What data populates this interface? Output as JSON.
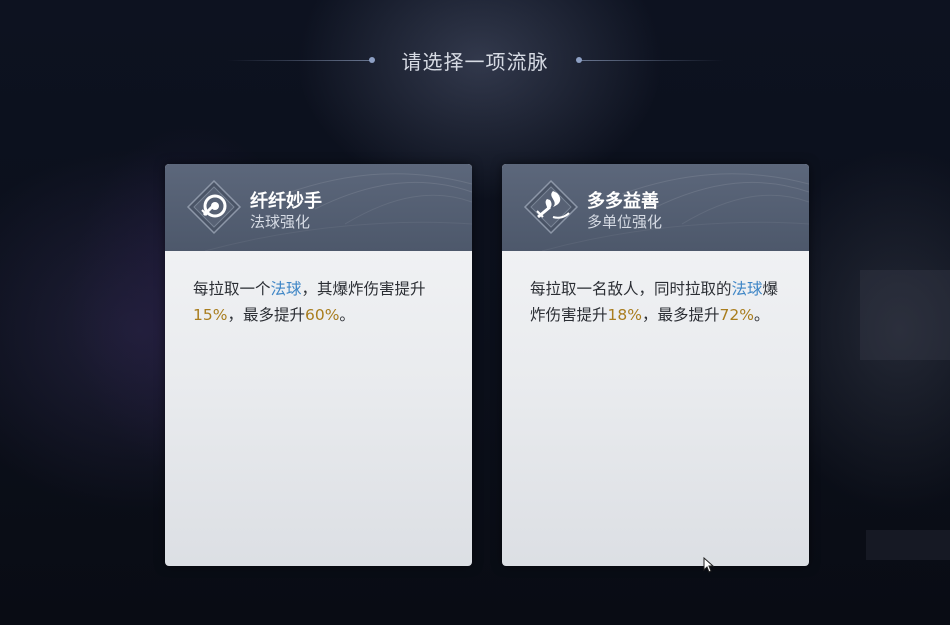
{
  "title": "请选择一项流脉",
  "colors": {
    "keyword": "#3f86c6",
    "number": "#a97d1e"
  },
  "cards": [
    {
      "name": "纤纤妙手",
      "subtitle": "法球强化",
      "icon": "orb-emblem-icon",
      "desc": {
        "p1": "每拉取一个",
        "k1": "法球",
        "p2": "，其爆炸伤害提升",
        "n1": "15%",
        "p3": "，最多提升",
        "n2": "60%",
        "p4": "。"
      }
    },
    {
      "name": "多多益善",
      "subtitle": "多单位强化",
      "icon": "multi-unit-emblem-icon",
      "desc": {
        "p1": "每拉取一名敌人，同时拉取的",
        "k1": "法球",
        "p2": "爆炸伤害提升",
        "n1": "18%",
        "p3": "，最多提升",
        "n2": "72%",
        "p4": "。"
      }
    }
  ]
}
